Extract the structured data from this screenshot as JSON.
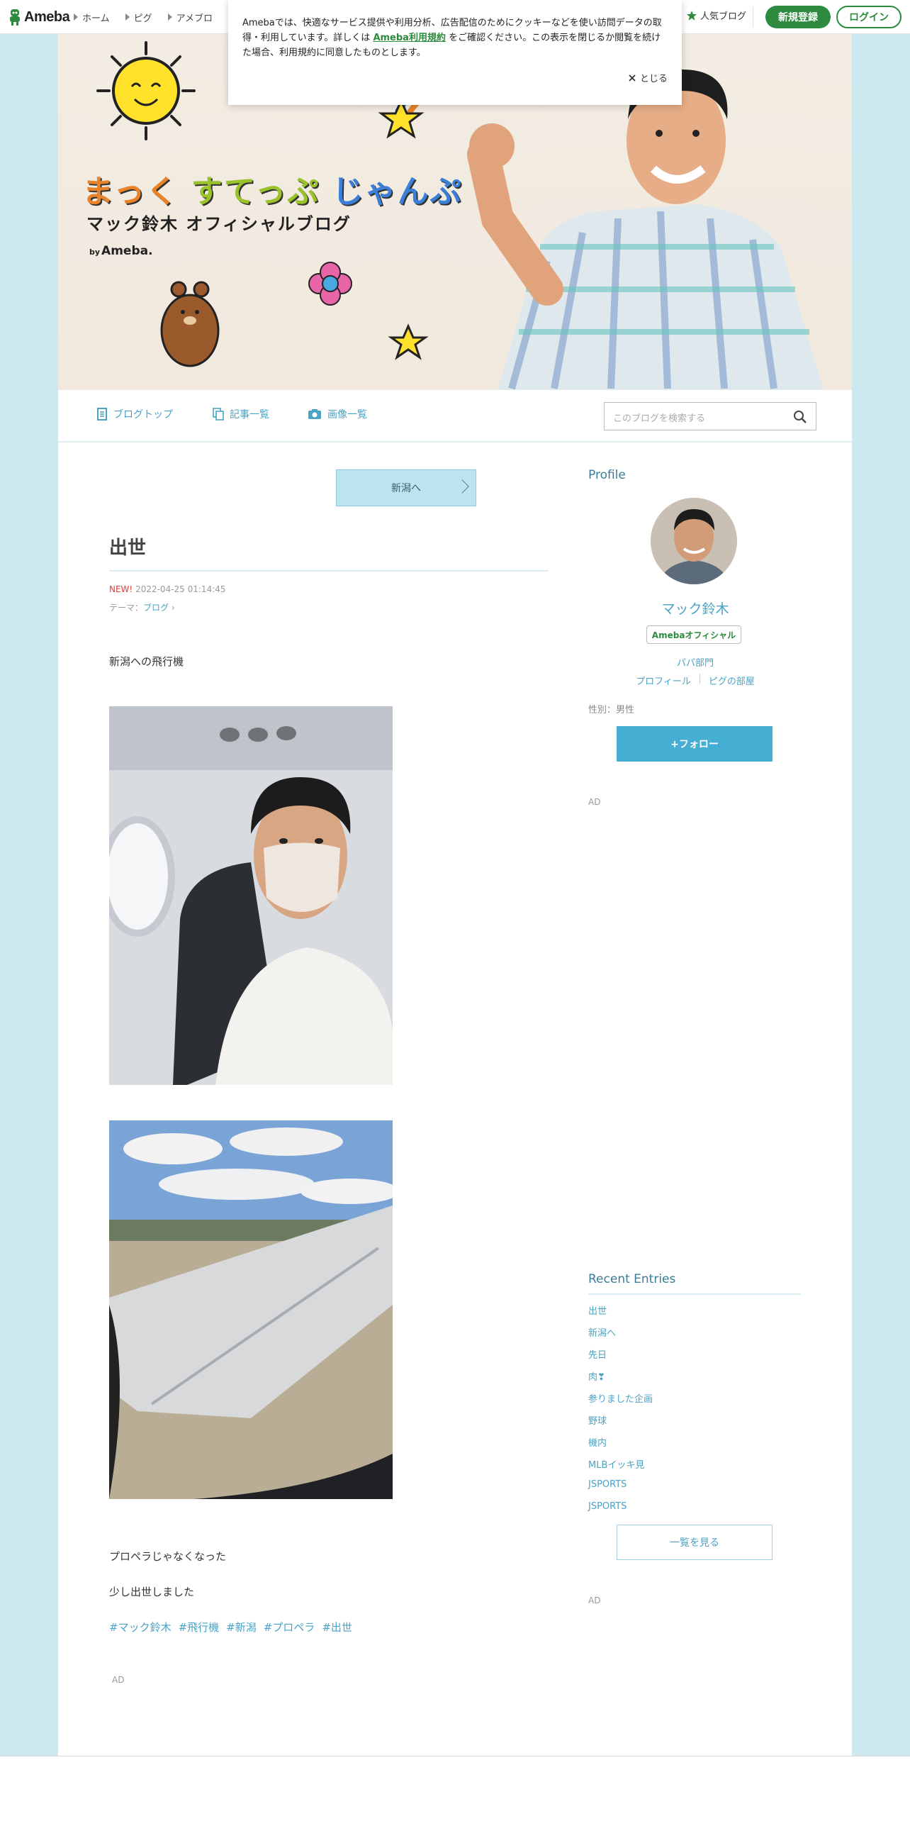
{
  "topbar": {
    "logo": "Ameba",
    "nav": [
      "ホーム",
      "ピグ",
      "アメブロ"
    ],
    "popular": "人気ブログ",
    "register": "新規登録",
    "login": "ログイン"
  },
  "cookie": {
    "text_before": "Amebaでは、快適なサービス提供や利用分析、広告配信のためにクッキーなどを使い訪問データの取得・利用しています。詳しくは",
    "link": "Ameba利用規約",
    "text_after": "をご確認ください。この表示を閉じるか閲覧を続けた場合、利用規約に同意したものとします。",
    "close": "とじる"
  },
  "header": {
    "title_part1": "まっく",
    "title_part2": "すてっぷ",
    "title_part3": "じゃんぷ",
    "subtitle": "マック鈴木 オフィシャルブログ",
    "by": "by",
    "ameba": "Ameba."
  },
  "blognav": {
    "top": "ブログトップ",
    "entries": "記事一覧",
    "images": "画像一覧",
    "search_placeholder": "このブログを検索する"
  },
  "post": {
    "prev": "新潟へ",
    "title": "出世",
    "new": "NEW!",
    "datetime": "2022-04-25 01:14:45",
    "theme_label": "テーマ：",
    "theme": "ブログ",
    "line1": "新潟への飛行機",
    "line2": "プロペラじゃなくなった",
    "line3": "少し出世しました",
    "hashtags": [
      "#マック鈴木",
      "#飛行機",
      "#新潟",
      "#プロペラ",
      "#出世"
    ],
    "ad": "AD"
  },
  "profile": {
    "heading": "Profile",
    "name": "マック鈴木",
    "badge": "Amebaオフィシャル",
    "category": "パパ部門",
    "link_profile": "プロフィール",
    "link_pig": "ピグの部屋",
    "gender": "性別：男性",
    "follow": "+フォロー",
    "ad": "AD"
  },
  "recent": {
    "heading": "Recent Entries",
    "items": [
      "出世",
      "新潟へ",
      "先日",
      "肉❣",
      "参りました企画",
      "野球",
      "機内",
      "MLBイッキ見",
      "JSPORTS",
      "JSPORTS"
    ],
    "all": "一覧を見る",
    "ad": "AD"
  },
  "colors": {
    "brand_green": "#2d8a3e",
    "link_blue": "#4aa3c5",
    "bg_blue": "#cde8ef"
  }
}
